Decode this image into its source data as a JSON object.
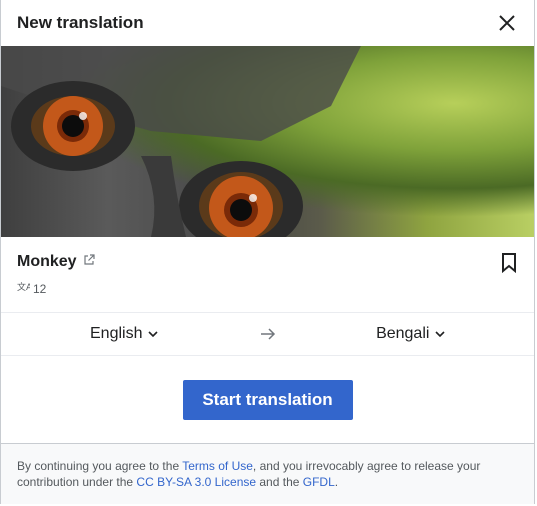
{
  "dialog": {
    "title": "New translation"
  },
  "article": {
    "title": "Monkey",
    "language_count": "12"
  },
  "languages": {
    "source": "English",
    "target": "Bengali"
  },
  "actions": {
    "start_label": "Start translation"
  },
  "footer": {
    "text_1": "By continuing you agree to the ",
    "terms_link": "Terms of Use",
    "text_2": ", and you irrevocably agree to release your contribution under the ",
    "license_link": "CC BY-SA 3.0 License",
    "text_3": " and the ",
    "gfdl_link": "GFDL",
    "text_4": "."
  },
  "colors": {
    "accent": "#3366cc",
    "text": "#202122",
    "muted": "#54595d"
  },
  "icons": [
    "close-icon",
    "external-link-icon",
    "bookmark-icon",
    "translate-icon",
    "chevron-down-icon",
    "arrow-right-icon"
  ]
}
